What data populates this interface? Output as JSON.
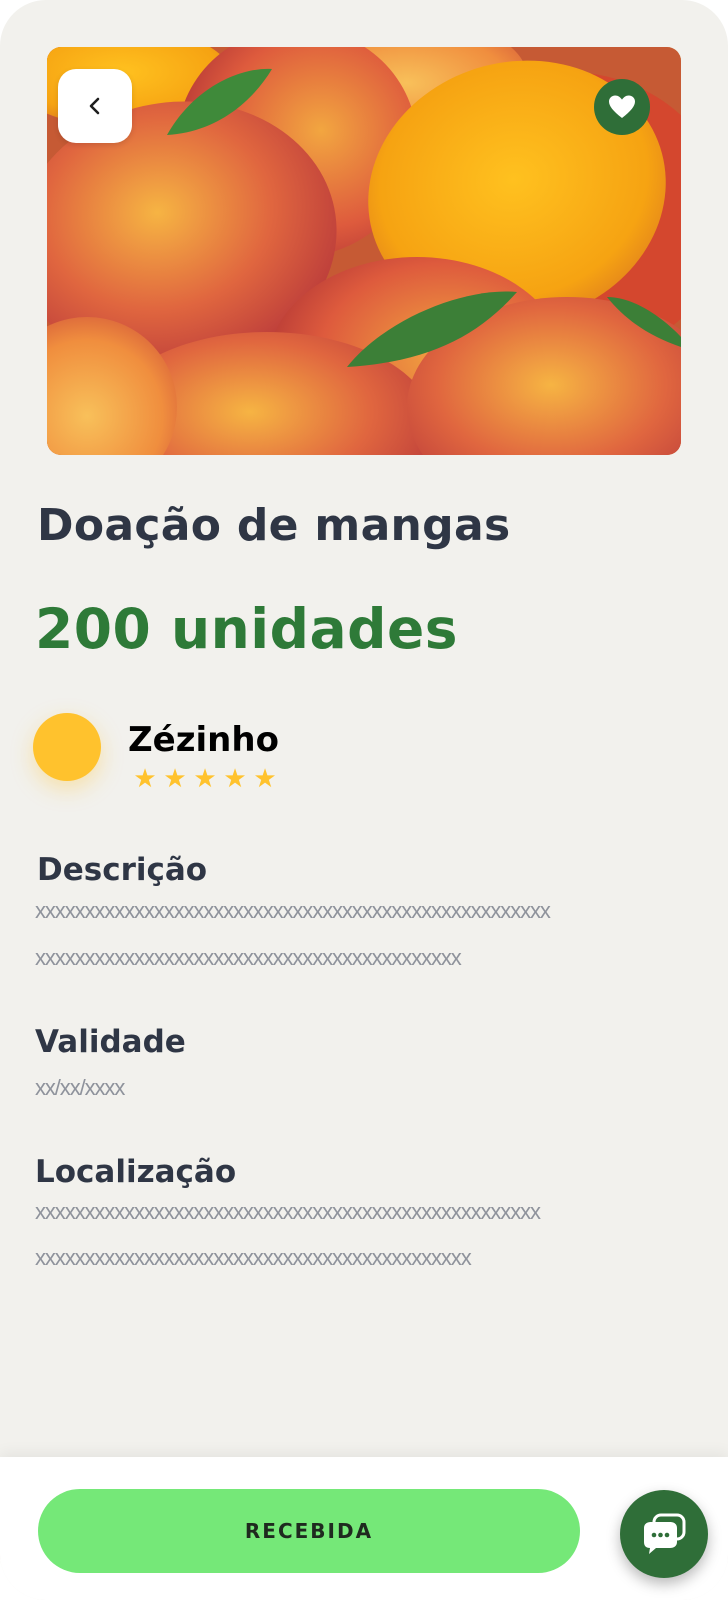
{
  "product": {
    "title": "Doação de mangas",
    "quantity": "200 unidades",
    "image_icon": "mango-photo",
    "favorite": true
  },
  "donor": {
    "name": "Zézinho",
    "rating": 5,
    "rating_max": 5
  },
  "details": {
    "description_label": "Descrição",
    "description_line1": "xxxxxxxxxxxxxxxxxxxxxxxxxxxxxxxxxxxxxxxxxxxxxxxxxxxx",
    "description_line2": "xxxxxxxxxxxxxxxxxxxxxxxxxxxxxxxxxxxxxxxxxxx",
    "validity_label": "Validade",
    "validity_value": "xx/xx/xxxx",
    "location_label": "Localização",
    "location_line1": "xxxxxxxxxxxxxxxxxxxxxxxxxxxxxxxxxxxxxxxxxxxxxxxxxxx",
    "location_line2": "xxxxxxxxxxxxxxxxxxxxxxxxxxxxxxxxxxxxxxxxxxxx"
  },
  "actions": {
    "primary_label": "RECEBIDA",
    "back_icon": "chevron-left-icon",
    "favorite_icon": "heart-icon",
    "chat_icon": "chat-bubbles-icon"
  },
  "colors": {
    "background": "#f2f1ed",
    "brand_green": "#2e7a38",
    "button_green": "#75e878",
    "accent_yellow": "#ffc22d",
    "heading": "#2f3645",
    "muted_text": "#8f939c"
  }
}
